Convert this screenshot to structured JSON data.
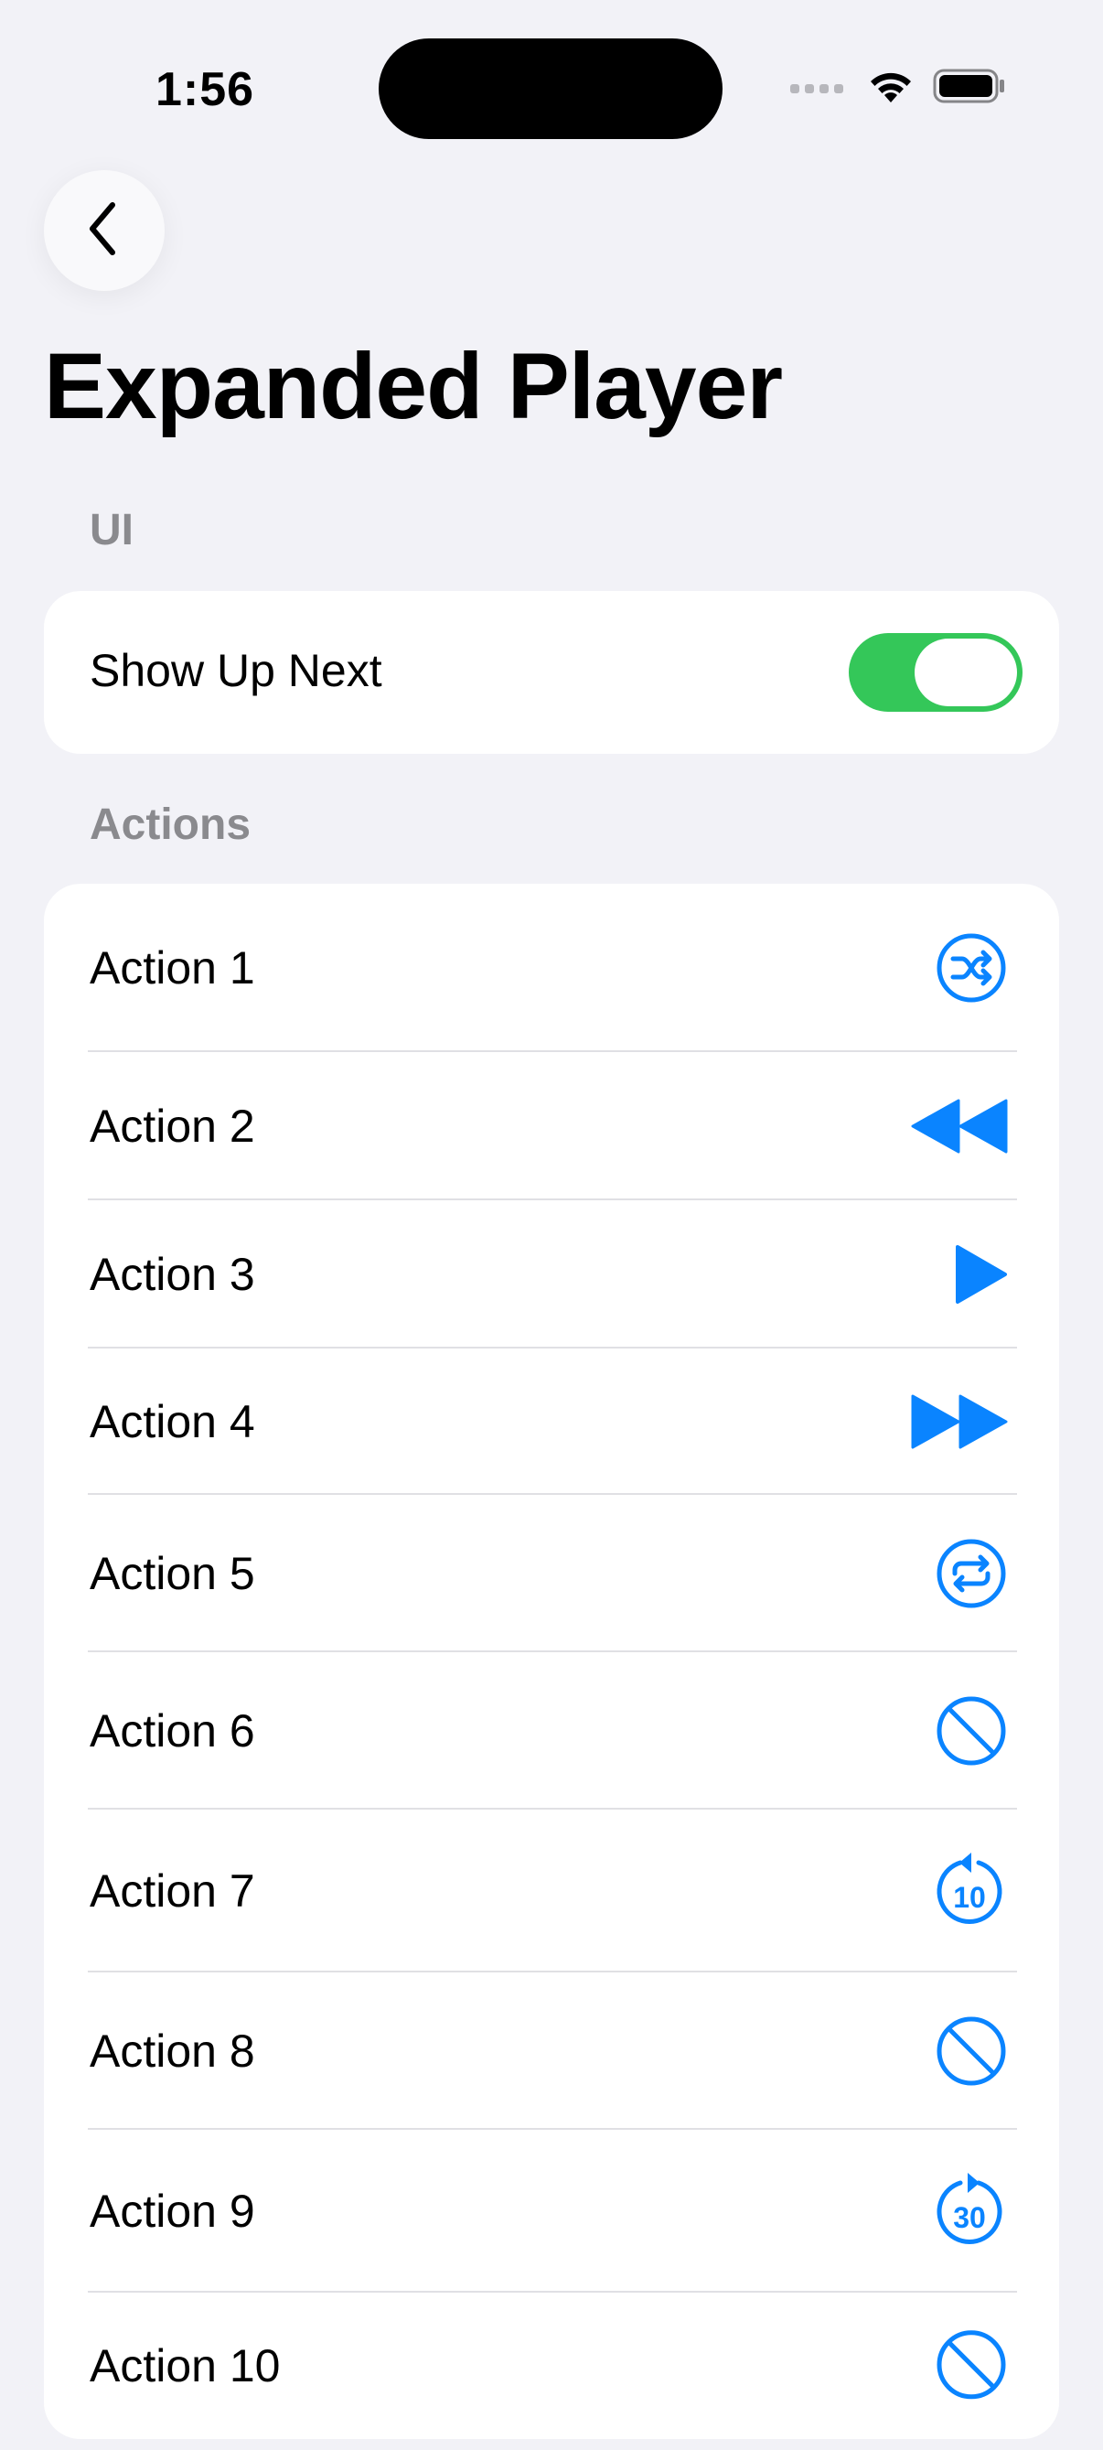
{
  "status_bar": {
    "time": "1:56"
  },
  "navigation": {
    "back_icon": "chevron-left-icon",
    "title": "Expanded Player"
  },
  "sections": {
    "ui": {
      "header": "UI",
      "rows": [
        {
          "label": "Show Up Next",
          "toggle_on": true
        }
      ]
    },
    "actions": {
      "header": "Actions",
      "rows": [
        {
          "label": "Action 1",
          "icon": "shuffle-circle-icon"
        },
        {
          "label": "Action 2",
          "icon": "backward-icon"
        },
        {
          "label": "Action 3",
          "icon": "play-icon"
        },
        {
          "label": "Action 4",
          "icon": "forward-icon"
        },
        {
          "label": "Action 5",
          "icon": "repeat-circle-icon"
        },
        {
          "label": "Action 6",
          "icon": "prohibited-icon"
        },
        {
          "label": "Action 7",
          "icon": "gobackward-10-icon",
          "icon_text": "10"
        },
        {
          "label": "Action 8",
          "icon": "prohibited-icon"
        },
        {
          "label": "Action 9",
          "icon": "goforward-30-icon",
          "icon_text": "30"
        },
        {
          "label": "Action 10",
          "icon": "prohibited-icon"
        }
      ]
    }
  },
  "colors": {
    "background": "#F2F2F7",
    "accent": "#0A84FF",
    "toggle_on": "#34C759",
    "secondary_text": "#8A8A8E"
  }
}
